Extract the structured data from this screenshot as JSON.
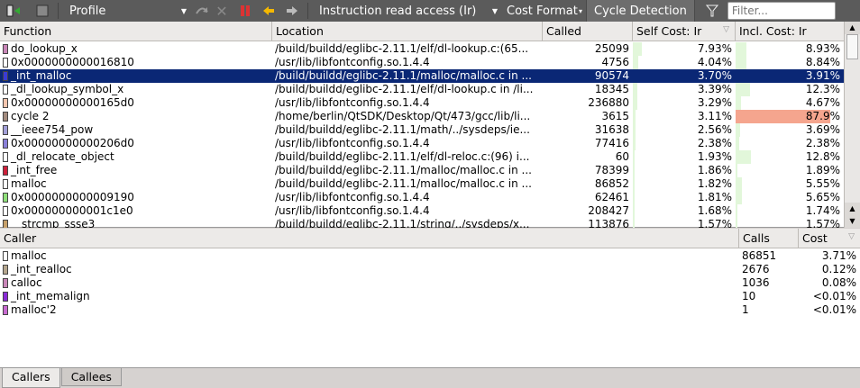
{
  "toolbar": {
    "profile_label": "Profile",
    "event_label": "Instruction read access (Ir)",
    "cost_format_label": "Cost Format",
    "cycle_detection_label": "Cycle Detection",
    "filter_placeholder": "Filter..."
  },
  "top_table": {
    "headers": {
      "function": "Function",
      "location": "Location",
      "called": "Called",
      "self_cost": "Self Cost: Ir",
      "incl_cost": "Incl. Cost: Ir"
    },
    "rows": [
      {
        "function": "do_lookup_x",
        "location": "/build/buildd/eglibc-2.11.1/elf/dl-lookup.c:(65...",
        "called": "25099",
        "self": "7.93%",
        "incl": "8.93%",
        "self_frac": 0.09,
        "incl_frac": 0.1,
        "swatch": "#c986b8",
        "selected": false
      },
      {
        "function": "0x0000000000016810",
        "location": "/usr/lib/libfontconfig.so.1.4.4",
        "called": "4756",
        "self": "4.04%",
        "incl": "8.84%",
        "self_frac": 0.05,
        "incl_frac": 0.1,
        "swatch": "#ffffff",
        "selected": false
      },
      {
        "function": "_int_malloc",
        "location": "/build/buildd/eglibc-2.11.1/malloc/malloc.c in ...",
        "called": "90574",
        "self": "3.70%",
        "incl": "3.91%",
        "self_frac": 0.04,
        "incl_frac": 0.04,
        "swatch": "#3b3bd6",
        "selected": true
      },
      {
        "function": "_dl_lookup_symbol_x",
        "location": "/build/buildd/eglibc-2.11.1/elf/dl-lookup.c in /li...",
        "called": "18345",
        "self": "3.39%",
        "incl": "12.3%",
        "self_frac": 0.04,
        "incl_frac": 0.13,
        "swatch": "#ffffff",
        "selected": false
      },
      {
        "function": "0x00000000000165d0",
        "location": "/usr/lib/libfontconfig.so.1.4.4",
        "called": "236880",
        "self": "3.29%",
        "incl": "4.67%",
        "self_frac": 0.04,
        "incl_frac": 0.05,
        "swatch": "#f4c6ae",
        "selected": false
      },
      {
        "function": "cycle 2",
        "location": "/home/berlin/QtSDK/Desktop/Qt/473/gcc/lib/li...",
        "called": "3615",
        "self": "3.11%",
        "incl": "87.9%",
        "self_frac": 0.03,
        "incl_frac": 0.879,
        "swatch": "#a38b7e",
        "selected": false
      },
      {
        "function": "__ieee754_pow",
        "location": "/build/buildd/eglibc-2.11.1/math/../sysdeps/ie...",
        "called": "31638",
        "self": "2.56%",
        "incl": "3.69%",
        "self_frac": 0.03,
        "incl_frac": 0.04,
        "swatch": "#a3a0d9",
        "selected": false
      },
      {
        "function": "0x00000000000206d0",
        "location": "/usr/lib/libfontconfig.so.1.4.4",
        "called": "77416",
        "self": "2.38%",
        "incl": "2.38%",
        "self_frac": 0.03,
        "incl_frac": 0.03,
        "swatch": "#8a80d8",
        "selected": false
      },
      {
        "function": "_dl_relocate_object",
        "location": "/build/buildd/eglibc-2.11.1/elf/dl-reloc.c:(96) i...",
        "called": "60",
        "self": "1.93%",
        "incl": "12.8%",
        "self_frac": 0.02,
        "incl_frac": 0.14,
        "swatch": "#ffffff",
        "selected": false
      },
      {
        "function": "_int_free",
        "location": "/build/buildd/eglibc-2.11.1/malloc/malloc.c in ...",
        "called": "78399",
        "self": "1.86%",
        "incl": "1.89%",
        "self_frac": 0.02,
        "incl_frac": 0.02,
        "swatch": "#cc1f3a",
        "selected": false
      },
      {
        "function": "malloc",
        "location": "/build/buildd/eglibc-2.11.1/malloc/malloc.c in ...",
        "called": "86852",
        "self": "1.82%",
        "incl": "5.55%",
        "self_frac": 0.02,
        "incl_frac": 0.06,
        "swatch": "#ffffff",
        "selected": false
      },
      {
        "function": "0x0000000000009190",
        "location": "/usr/lib/libfontconfig.so.1.4.4",
        "called": "62461",
        "self": "1.81%",
        "incl": "5.65%",
        "self_frac": 0.02,
        "incl_frac": 0.06,
        "swatch": "#8fe07a",
        "selected": false
      },
      {
        "function": "0x000000000001c1e0",
        "location": "/usr/lib/libfontconfig.so.1.4.4",
        "called": "208427",
        "self": "1.68%",
        "incl": "1.74%",
        "self_frac": 0.02,
        "incl_frac": 0.02,
        "swatch": "#ffffff",
        "selected": false
      },
      {
        "function": "__strcmp_ssse3",
        "location": "/build/buildd/eglibc-2.11.1/string/../sysdeps/x...",
        "called": "113876",
        "self": "1.57%",
        "incl": "1.57%",
        "self_frac": 0.02,
        "incl_frac": 0.02,
        "swatch": "#c6a06a",
        "selected": false
      }
    ]
  },
  "bottom_table": {
    "headers": {
      "caller": "Caller",
      "calls": "Calls",
      "cost": "Cost"
    },
    "rows": [
      {
        "caller": "malloc",
        "calls": "86851",
        "cost": "3.71%",
        "swatch": "#ffffff"
      },
      {
        "caller": "_int_realloc",
        "calls": "2676",
        "cost": "0.12%",
        "swatch": "#b5a68e"
      },
      {
        "caller": "calloc",
        "calls": "1036",
        "cost": "0.08%",
        "swatch": "#c986b8"
      },
      {
        "caller": "_int_memalign",
        "calls": "10",
        "cost": "<0.01%",
        "swatch": "#8a2bd6"
      },
      {
        "caller": "malloc'2",
        "calls": "1",
        "cost": "<0.01%",
        "swatch": "#c86ad0"
      }
    ]
  },
  "tabs": [
    {
      "label": "Callers",
      "active": true
    },
    {
      "label": "Callees",
      "active": false
    }
  ],
  "colors": {
    "toolbar_bg": "#5b5b5b",
    "selection_bg": "#0a2775",
    "self_bar": "#e2f7da",
    "incl_bar": "#e2f7da",
    "incl_bar_high": "#f5a58e"
  }
}
